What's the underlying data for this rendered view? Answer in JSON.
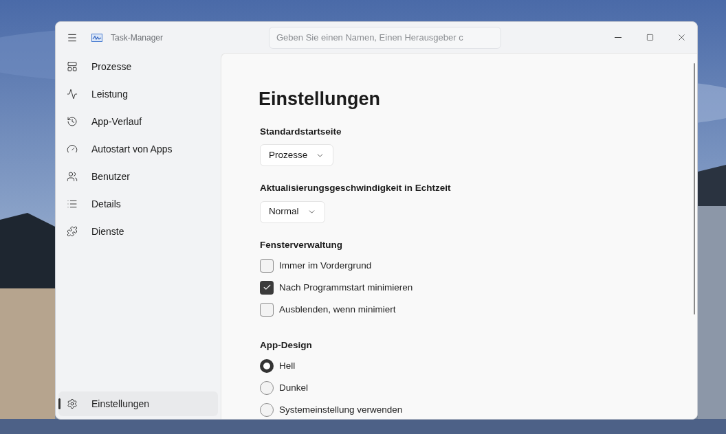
{
  "window": {
    "title": "Task-Manager"
  },
  "search": {
    "placeholder": "Geben Sie einen Namen, Einen Herausgeber c"
  },
  "sidebar": {
    "items": [
      {
        "label": "Prozesse",
        "selected": false
      },
      {
        "label": "Leistung",
        "selected": false
      },
      {
        "label": "App-Verlauf",
        "selected": false
      },
      {
        "label": "Autostart von Apps",
        "selected": false
      },
      {
        "label": "Benutzer",
        "selected": false
      },
      {
        "label": "Details",
        "selected": false
      },
      {
        "label": "Dienste",
        "selected": false
      }
    ],
    "footer_item": {
      "label": "Einstellungen",
      "selected": true
    }
  },
  "page": {
    "title": "Einstellungen",
    "dropdowns": [
      {
        "label": "Standardstartseite",
        "value": "Prozesse"
      },
      {
        "label": "Aktualisierungsgeschwindigkeit in Echtzeit",
        "value": "Normal"
      }
    ],
    "window_management": {
      "label": "Fensterverwaltung",
      "options": [
        {
          "label": "Immer im Vordergrund",
          "checked": false
        },
        {
          "label": "Nach Programmstart minimieren",
          "checked": true
        },
        {
          "label": "Ausblenden, wenn minimiert",
          "checked": false
        }
      ]
    },
    "app_design": {
      "label": "App-Design",
      "options": [
        {
          "label": "Hell",
          "selected": true
        },
        {
          "label": "Dunkel",
          "selected": false
        },
        {
          "label": "Systemeinstellung verwenden",
          "selected": false
        }
      ]
    }
  }
}
